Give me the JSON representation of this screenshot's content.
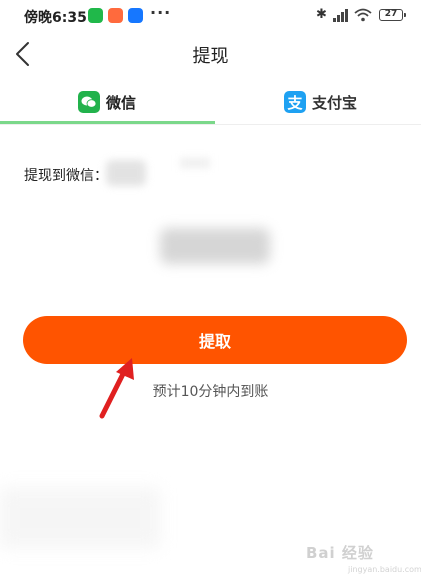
{
  "status_bar": {
    "time": "傍晚6:35",
    "dots": "···",
    "battery": "27",
    "icons": [
      "wechat-app-icon",
      "orange-app-icon",
      "alipay-app-icon",
      "bluetooth-icon",
      "signal-icon",
      "wifi-icon",
      "battery-icon"
    ]
  },
  "header": {
    "title": "提现",
    "back_icon": "chevron-left-icon"
  },
  "tabs": [
    {
      "label": "微信",
      "icon": "wechat-icon",
      "selected": true
    },
    {
      "label": "支付宝",
      "icon": "alipay-icon",
      "selected": false
    }
  ],
  "content": {
    "withdraw_to_label": "提现到微信：",
    "button_label": "提取",
    "arrival_note": "预计10分钟内到账"
  },
  "watermark": {
    "text": "Bai 经验",
    "sub": "jingyan.baidu.com"
  },
  "colors": {
    "primary_button": "#ff5400",
    "tab_indicator": "#7bd88a",
    "wechat_green": "#22b24c",
    "alipay_blue": "#1ea1f2",
    "arrow_red": "#e02020"
  }
}
